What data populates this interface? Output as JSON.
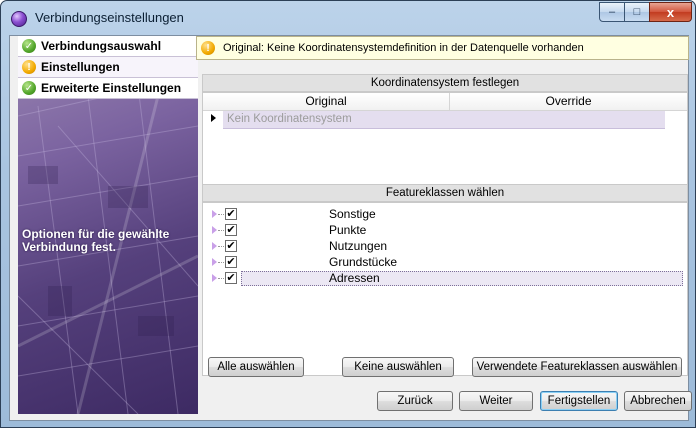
{
  "window": {
    "title": "Verbindungseinstellungen",
    "close_glyph": "x",
    "min_glyph": "–",
    "max_glyph": "□"
  },
  "sidebar": {
    "items": [
      {
        "label": "Verbindungsauswahl",
        "icon": "check-icon",
        "state": "done"
      },
      {
        "label": "Einstellungen",
        "icon": "warning-icon",
        "state": "active"
      },
      {
        "label": "Erweiterte Einstellungen",
        "icon": "check-icon",
        "state": "done"
      }
    ],
    "description": "Optionen für die gewählte Verbindung fest."
  },
  "info": {
    "text": "Original: Keine Koordinatensystemdefinition in der Datenquelle vorhanden"
  },
  "coordinate_system": {
    "header": "Koordinatensystem festlegen",
    "columns": [
      "Original",
      "Override"
    ],
    "rows": [
      {
        "original": "Kein Koordinatensystem",
        "override": ""
      }
    ]
  },
  "feature_classes": {
    "header": "Featureklassen wählen",
    "items": [
      {
        "label": "Sonstige",
        "checked": true
      },
      {
        "label": "Punkte",
        "checked": true
      },
      {
        "label": "Nutzungen",
        "checked": true
      },
      {
        "label": "Grundstücke",
        "checked": true
      },
      {
        "label": "Adressen",
        "checked": true
      }
    ],
    "check_glyph": "✔"
  },
  "buttons": {
    "select_all": "Alle auswählen",
    "select_none": "Keine auswählen",
    "select_used": "Verwendete Featureklassen auswählen",
    "back": "Zurück",
    "next": "Weiter",
    "finish": "Fertigstellen",
    "cancel": "Abbrechen"
  },
  "colors": {
    "accent_purple": "#6a4f95",
    "ok_green": "#52a52a",
    "warn_orange": "#f2a900",
    "info_bg": "#ffffe1"
  }
}
